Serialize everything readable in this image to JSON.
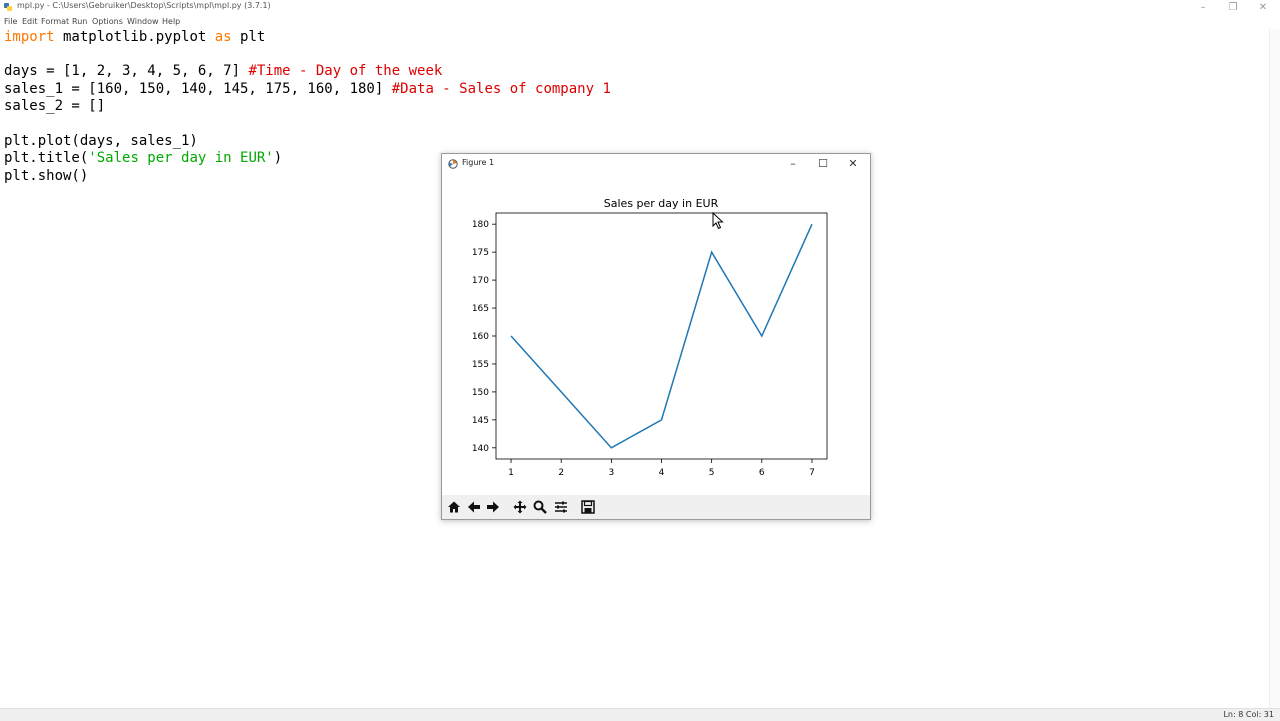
{
  "window": {
    "title": "mpl.py - C:\\Users\\Gebruiker\\Desktop\\Scripts\\mpl\\mpl.py (3.7.1)",
    "controls": [
      "–",
      "❐",
      "✕"
    ]
  },
  "menubar": {
    "items": [
      "File",
      "Edit",
      "Format",
      "Run",
      "Options",
      "Window",
      "Help"
    ]
  },
  "editor": {
    "lines": [
      {
        "kw1": "import",
        "plain": " matplotlib.pyplot ",
        "kw2": "as",
        "rest": " plt"
      },
      {
        "plain": "days = [1, 2, 3, 4, 5, 6, 7] ",
        "comment": "#Time - Day of the week"
      },
      {
        "plain": "sales_1 = [160, 150, 140, 145, 175, 160, 180] ",
        "comment": "#Data - Sales of company 1"
      },
      {
        "plain": "sales_2 = []"
      },
      {
        "plain": "plt.plot(days, sales_1)"
      },
      {
        "plain": "plt.title(",
        "string": "'Sales per day in EUR'",
        "rest": ")"
      },
      {
        "plain": "plt.show()"
      }
    ]
  },
  "statusbar": {
    "text": "Ln: 8  Col: 31"
  },
  "figure": {
    "title": "Figure 1",
    "controls": [
      "–",
      "☐",
      "✕"
    ],
    "toolbar_icons": [
      "home-icon",
      "back-arrow-icon",
      "forward-arrow-icon",
      "pan-icon",
      "zoom-icon",
      "subplots-icon",
      "save-icon"
    ]
  },
  "chart_data": {
    "type": "line",
    "title": "Sales per day in EUR",
    "xlabel": "",
    "ylabel": "",
    "x": [
      1,
      2,
      3,
      4,
      5,
      6,
      7
    ],
    "series": [
      {
        "values": [
          160,
          150,
          140,
          145,
          175,
          160,
          180
        ],
        "color": "#1f77b4"
      }
    ],
    "xticks": [
      1,
      2,
      3,
      4,
      5,
      6,
      7
    ],
    "yticks": [
      140,
      145,
      150,
      155,
      160,
      165,
      170,
      175,
      180
    ],
    "xlim": [
      0.7,
      7.3
    ],
    "ylim": [
      138,
      182
    ],
    "grid": false,
    "legend": false
  }
}
